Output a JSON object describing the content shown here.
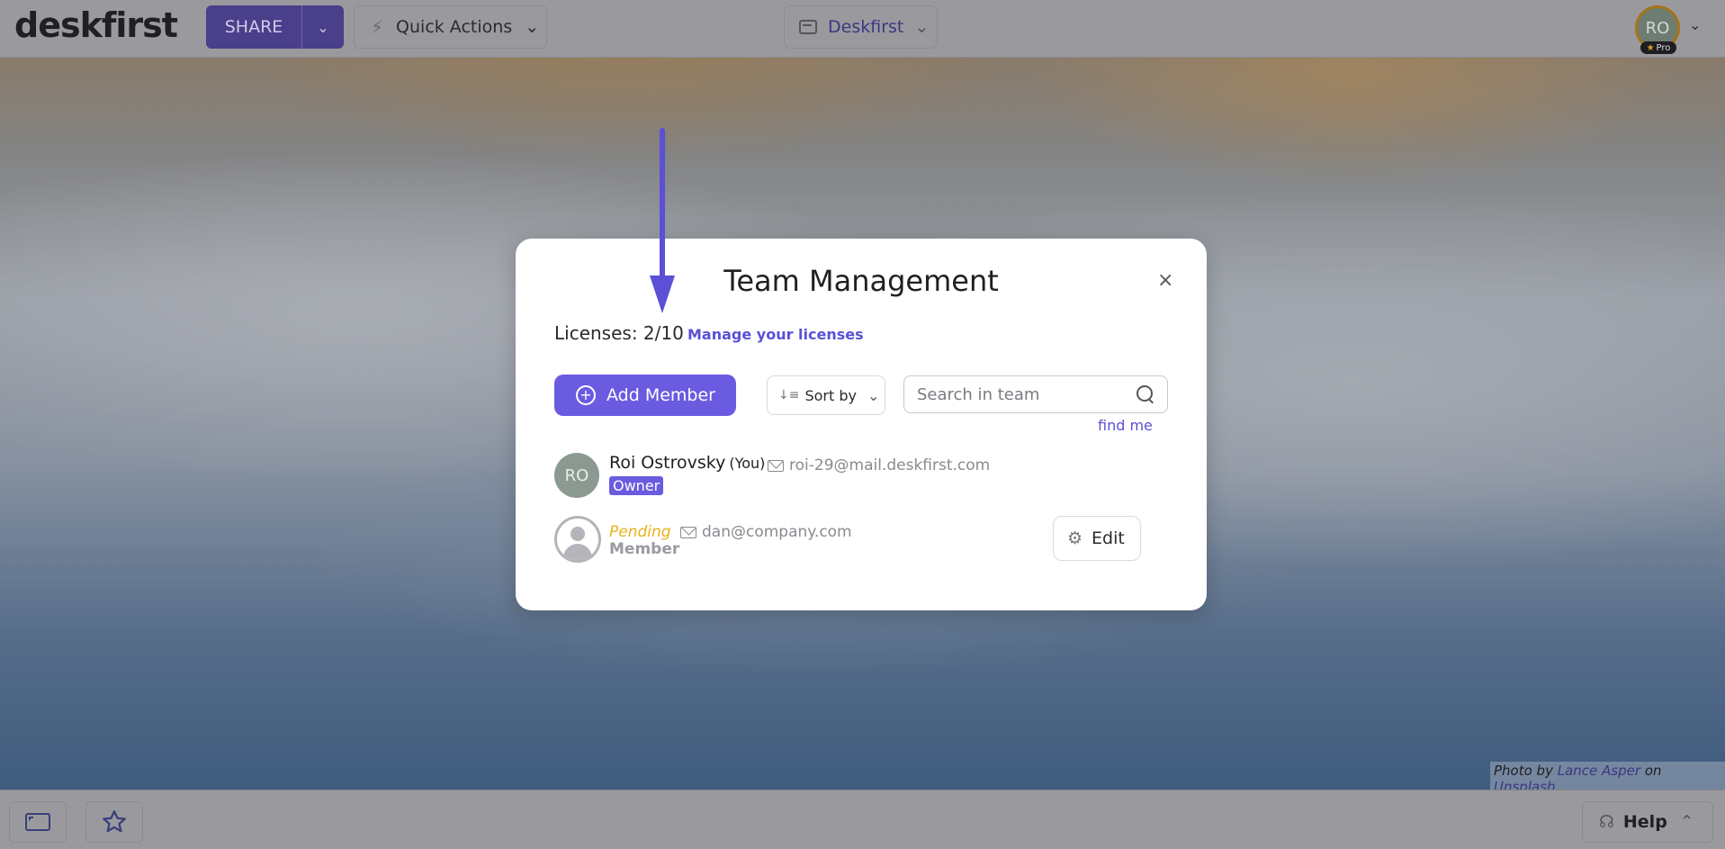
{
  "topbar": {
    "logo": "deskfirst",
    "share_label": "SHARE",
    "quick_actions_label": "Quick Actions",
    "workspace_label": "Deskfirst",
    "avatar_initials": "RO",
    "pro_label": "Pro"
  },
  "modal": {
    "title": "Team Management",
    "close_glyph": "×",
    "licenses_text": "Licenses: 2/10",
    "manage_link": "Manage your licenses",
    "add_member_label": "Add Member",
    "sort_label": "Sort by",
    "search_placeholder": "Search in team",
    "find_me_label": "find me",
    "members": [
      {
        "initials": "RO",
        "name": "Roi Ostrovsky",
        "you_label": "(You)",
        "email": "roi-29@mail.deskfirst.com",
        "role": "Owner"
      },
      {
        "status": "Pending",
        "email": "dan@company.com",
        "role": "Member",
        "edit_label": "Edit"
      }
    ]
  },
  "footer": {
    "help_label": "Help",
    "credit_prefix": "Photo by",
    "credit_author": "Lance Asper",
    "credit_on": "on",
    "credit_site": "Unsplash"
  },
  "colors": {
    "accent": "#6a5be0",
    "pending": "#e7b21b",
    "arrow": "#5b50d6"
  },
  "icons": {
    "quick_actions": "lightning-icon",
    "workspace": "window-icon",
    "sort": "sort-icon",
    "search": "search-icon",
    "email": "envelope-icon",
    "edit": "gear-icon",
    "fullscreen": "fullscreen-icon",
    "favorite": "star-icon",
    "help": "headphones-icon"
  }
}
